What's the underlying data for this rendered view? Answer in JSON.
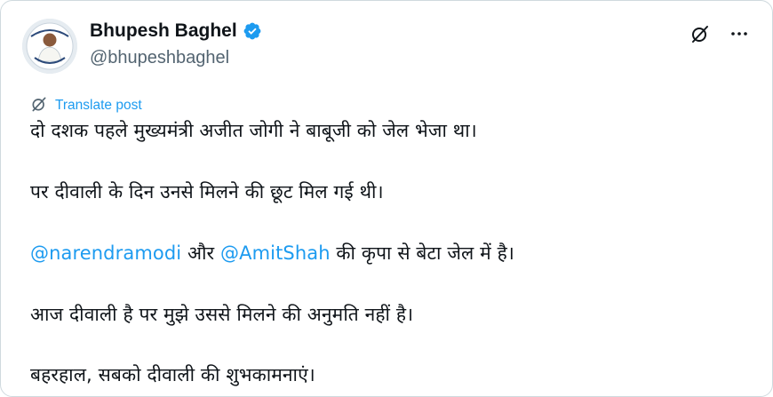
{
  "author": {
    "display_name": "Bhupesh Baghel",
    "handle": "@bhupeshbaghel",
    "verified_icon": "verified-badge-icon",
    "avatar_icon": "profile-avatar"
  },
  "top_actions": {
    "grok_icon": "grok-icon",
    "more_icon": "more-options-icon"
  },
  "translate": {
    "label": "Translate post",
    "icon": "translate-icon"
  },
  "post": {
    "line1": "दो दशक पहले मुख्यमंत्री अजीत जोगी ने बाबूजी को जेल भेजा था।",
    "line2": "पर दीवाली के दिन उनसे मिलने की छूट मिल गई थी।",
    "line3": {
      "mention1": "@narendramodi",
      "text_between": " और ",
      "mention2": "@AmitShah",
      "text_after": " की कृपा से बेटा जेल में है।"
    },
    "line4": "आज दीवाली है पर मुझे उससे मिलने की अनुमति नहीं है।",
    "line5": "बहरहाल, सबको दीवाली की शुभकामनाएं।"
  },
  "colors": {
    "text": "#0f1419",
    "secondary_text": "#536471",
    "link": "#1d9bf0",
    "border": "#cfd9de"
  }
}
